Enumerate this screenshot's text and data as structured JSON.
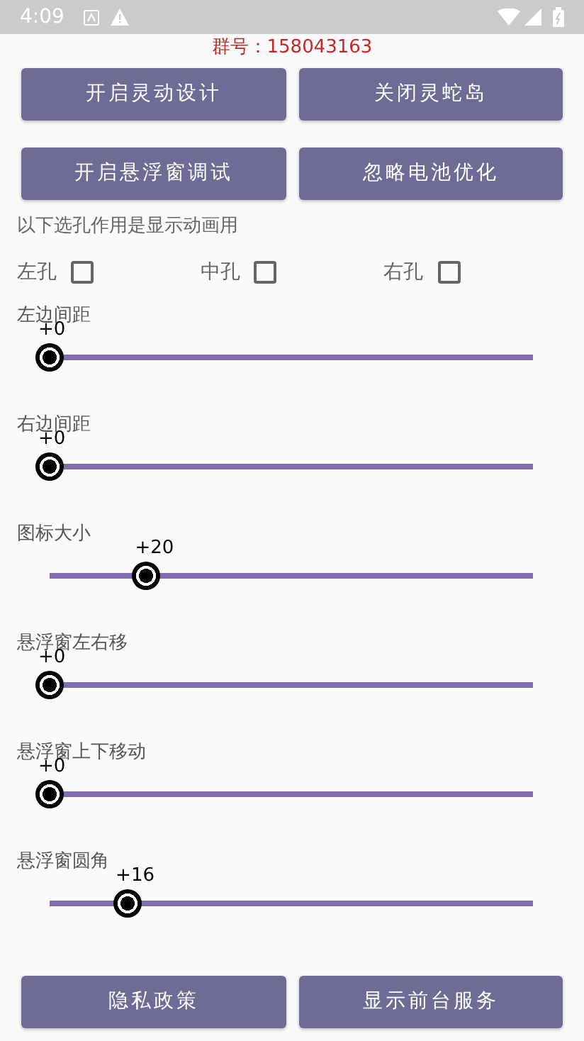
{
  "status_bar": {
    "time": "4:09"
  },
  "group_number": "群号：158043163",
  "top_buttons": [
    {
      "label": "开启灵动设计"
    },
    {
      "label": "关闭灵蛇岛"
    },
    {
      "label": "开启悬浮窗调试"
    },
    {
      "label": "忽略电池优化"
    }
  ],
  "hole_hint": "以下选孔作用是显示动画用",
  "holes": [
    {
      "label": "左孔",
      "checked": false
    },
    {
      "label": "中孔",
      "checked": false
    },
    {
      "label": "右孔",
      "checked": false
    }
  ],
  "sliders": [
    {
      "label": "左边间距",
      "reading": "+0",
      "level": 0
    },
    {
      "label": "右边间距",
      "reading": "+0",
      "level": 0
    },
    {
      "label": "图标大小",
      "reading": "+20",
      "level": 0.2
    },
    {
      "label": "悬浮窗左右移",
      "reading": "+0",
      "level": 0
    },
    {
      "label": "悬浮窗上下移动",
      "reading": "+0",
      "level": 0
    },
    {
      "label": "悬浮窗圆角",
      "reading": "+16",
      "level": 0.16
    }
  ],
  "bottom_buttons": [
    {
      "label": "隐私政策"
    },
    {
      "label": "显示前台服务"
    }
  ]
}
